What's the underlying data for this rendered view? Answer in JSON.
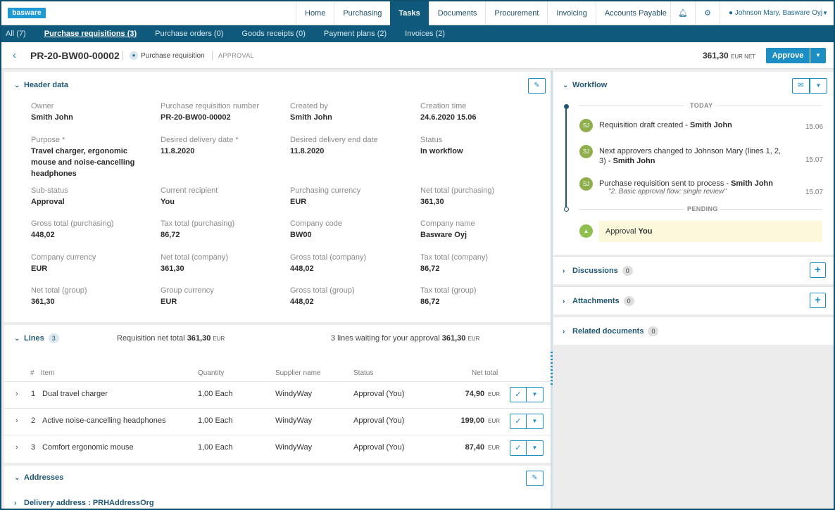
{
  "brand": {
    "logo_text": "basware"
  },
  "top_nav": {
    "items": [
      "Home",
      "Purchasing",
      "Tasks",
      "Documents",
      "Procurement",
      "Invoicing",
      "Accounts Payable"
    ],
    "active": "Tasks",
    "user": "Johnson Mary, Basware Oyj"
  },
  "sub_nav": {
    "items": [
      "All (7)",
      "Purchase requisitions (3)",
      "Purchase orders (0)",
      "Goods receipts (0)",
      "Payment plans (2)",
      "Invoices (2)"
    ],
    "active": "Purchase requisitions (3)"
  },
  "title_bar": {
    "doc_id": "PR-20-BW00-00002",
    "doc_type": "Purchase requisition",
    "doc_state": "APPROVAL",
    "amount": "361,30",
    "amount_currency": "EUR NET",
    "approve_label": "Approve"
  },
  "header_data": {
    "title": "Header data",
    "fields": [
      {
        "label": "Owner",
        "value": "Smith John"
      },
      {
        "label": "Purchase requisition number",
        "value": "PR-20-BW00-00002"
      },
      {
        "label": "Created by",
        "value": "Smith John"
      },
      {
        "label": "Creation time",
        "value": "24.6.2020 15.06"
      },
      {
        "label": "Purpose  *",
        "value": "Travel charger, ergonomic mouse and noise-cancelling headphones"
      },
      {
        "label": "Desired delivery date  *",
        "value": "11.8.2020"
      },
      {
        "label": "Desired delivery end date",
        "value": "11.8.2020"
      },
      {
        "label": "Status",
        "value": "In workflow"
      },
      {
        "label": "Sub-status",
        "value": "Approval"
      },
      {
        "label": "Current recipient",
        "value": "You"
      },
      {
        "label": "Purchasing currency",
        "value": "EUR"
      },
      {
        "label": "Net total (purchasing)",
        "value": "361,30"
      },
      {
        "label": "Gross total (purchasing)",
        "value": "448,02"
      },
      {
        "label": "Tax total (purchasing)",
        "value": "86,72"
      },
      {
        "label": "Company code",
        "value": "BW00"
      },
      {
        "label": "Company name",
        "value": "Basware Oyj"
      },
      {
        "label": "Company currency",
        "value": "EUR"
      },
      {
        "label": "Net total (company)",
        "value": "361,30"
      },
      {
        "label": "Gross total (company)",
        "value": "448,02"
      },
      {
        "label": "Tax total (company)",
        "value": "86,72"
      },
      {
        "label": "Net total (group)",
        "value": "361,30"
      },
      {
        "label": "Group currency",
        "value": "EUR"
      },
      {
        "label": "Gross total (group)",
        "value": "448,02"
      },
      {
        "label": "Tax total (group)",
        "value": "86,72"
      }
    ]
  },
  "lines": {
    "title": "Lines",
    "count": "3",
    "net_total_label": "Requisition net total",
    "net_total_value": "361,30",
    "net_total_currency": "EUR",
    "waiting_label": "3 lines waiting for your approval",
    "waiting_value": "361,30",
    "waiting_currency": "EUR",
    "columns": [
      "#",
      "Item",
      "Quantity",
      "Supplier name",
      "Status",
      "Net total"
    ],
    "rows": [
      {
        "num": "1",
        "item": "Dual travel charger",
        "qty": "1,00 Each",
        "supplier": "WindyWay",
        "status": "Approval (You)",
        "net": "74,90",
        "cur": "EUR"
      },
      {
        "num": "2",
        "item": "Active noise-cancelling headphones",
        "qty": "1,00 Each",
        "supplier": "WindyWay",
        "status": "Approval (You)",
        "net": "199,00",
        "cur": "EUR"
      },
      {
        "num": "3",
        "item": "Comfort ergonomic mouse",
        "qty": "1,00 Each",
        "supplier": "WindyWay",
        "status": "Approval (You)",
        "net": "87,40",
        "cur": "EUR"
      }
    ]
  },
  "addresses": {
    "title": "Addresses",
    "delivery_label": "Delivery address : PRHAddressOrg"
  },
  "workflow": {
    "title": "Workflow",
    "today_label": "TODAY",
    "pending_label": "PENDING",
    "events": [
      {
        "initials": "SJ",
        "text": "Requisition draft created - ",
        "actor": "Smith John",
        "time": "15.06",
        "note": ""
      },
      {
        "initials": "SJ",
        "text": "Next approvers changed to Johnson Mary (lines 1, 2, 3) - ",
        "actor": "Smith John",
        "time": "15.07",
        "note": ""
      },
      {
        "initials": "SJ",
        "text": "Purchase requisition sent to process - ",
        "actor": "Smith John",
        "time": "15.07",
        "note": "\"2. Basic approval flow: single review\""
      }
    ],
    "pending": {
      "text": "Approval ",
      "actor": "You"
    }
  },
  "right_sections": [
    {
      "title": "Discussions",
      "count": "0",
      "has_add": true
    },
    {
      "title": "Attachments",
      "count": "0",
      "has_add": true
    },
    {
      "title": "Related documents",
      "count": "0",
      "has_add": false
    }
  ]
}
